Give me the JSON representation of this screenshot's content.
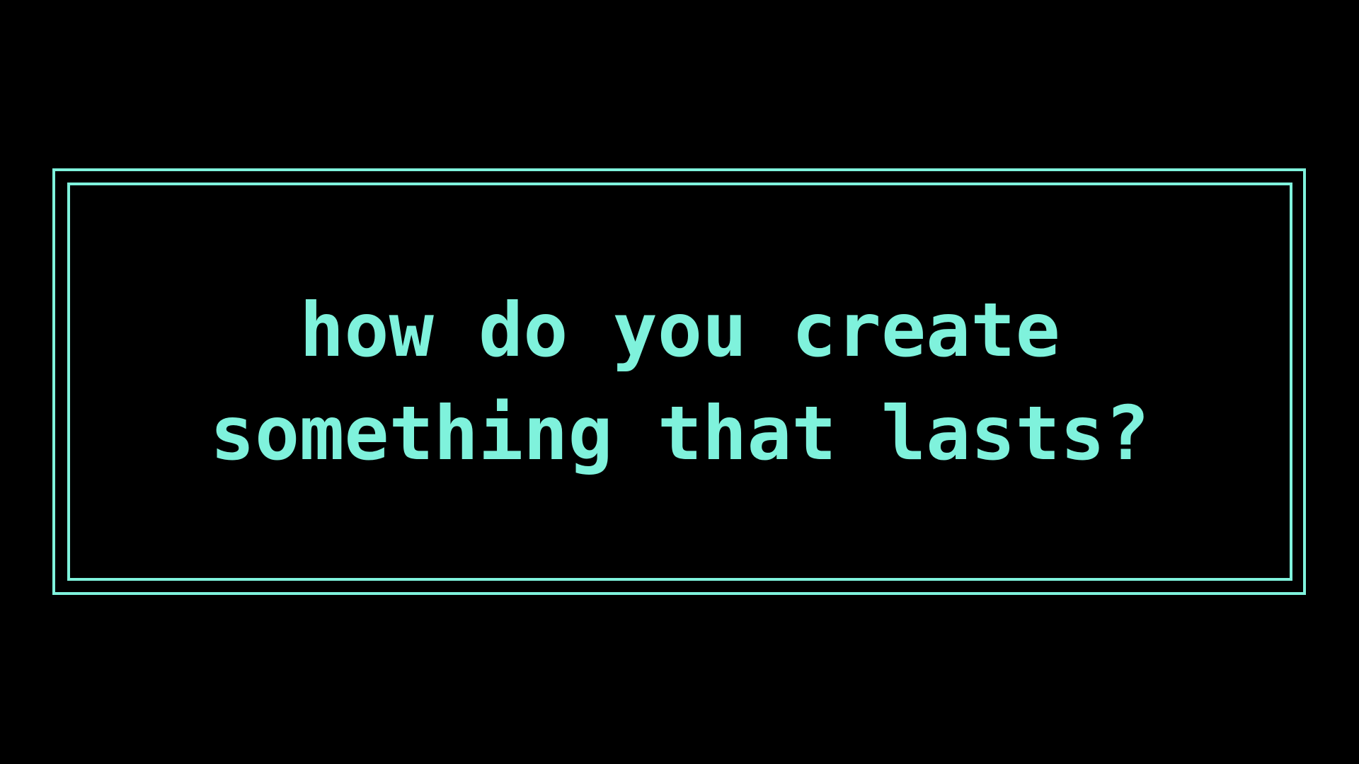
{
  "slide": {
    "title_lines": [
      "how do you create",
      "something that lasts?"
    ]
  },
  "colors": {
    "background": "#000000",
    "accent": "#7ff2dc"
  }
}
